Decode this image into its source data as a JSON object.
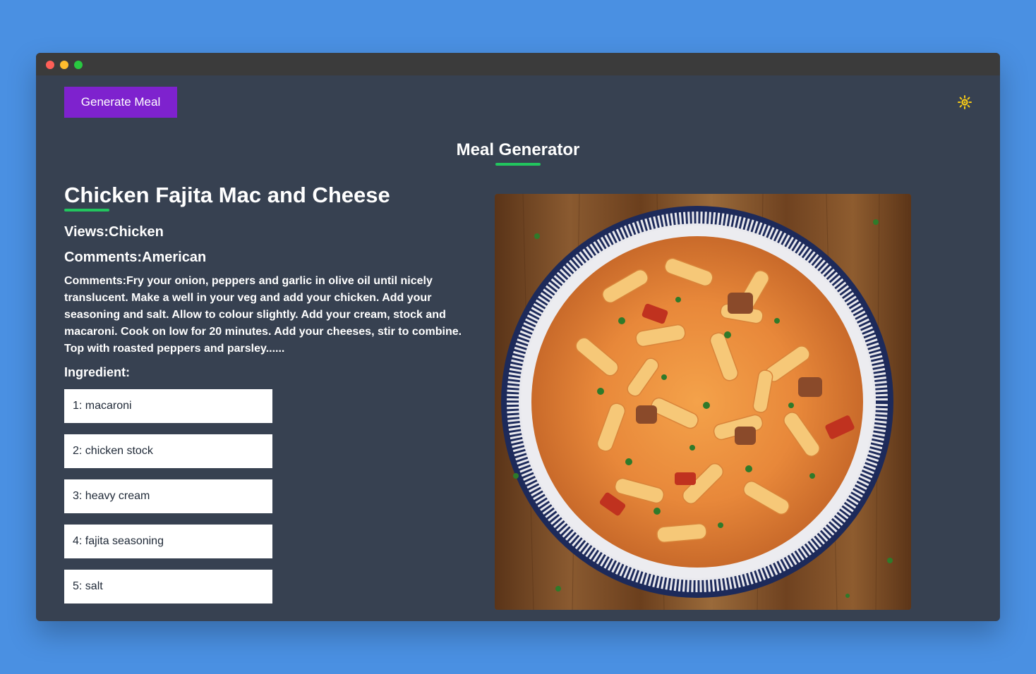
{
  "header": {
    "generate_label": "Generate Meal",
    "theme_icon": "sun-icon"
  },
  "page": {
    "title": "Meal Generator"
  },
  "meal": {
    "name": "Chicken Fajita Mac and Cheese",
    "views": "Views:Chicken",
    "area": "Comments:American",
    "instructions": "Comments:Fry your onion, peppers and garlic in olive oil until nicely translucent. Make a well in your veg and add your chicken. Add your seasoning and salt. Allow to colour slightly. Add your cream, stock and macaroni. Cook on low for 20 minutes. Add your cheeses, stir to combine. Top with roasted peppers and parsley......",
    "ingredient_heading": "Ingredient:",
    "ingredients": [
      "1: macaroni",
      "2: chicken stock",
      "3: heavy cream",
      "4: fajita seasoning",
      "5: salt"
    ]
  },
  "colors": {
    "accent": "#7e22ce",
    "underline": "#22c55e",
    "background": "#374151",
    "desktop": "#4a90e2",
    "sun": "#facc15"
  }
}
